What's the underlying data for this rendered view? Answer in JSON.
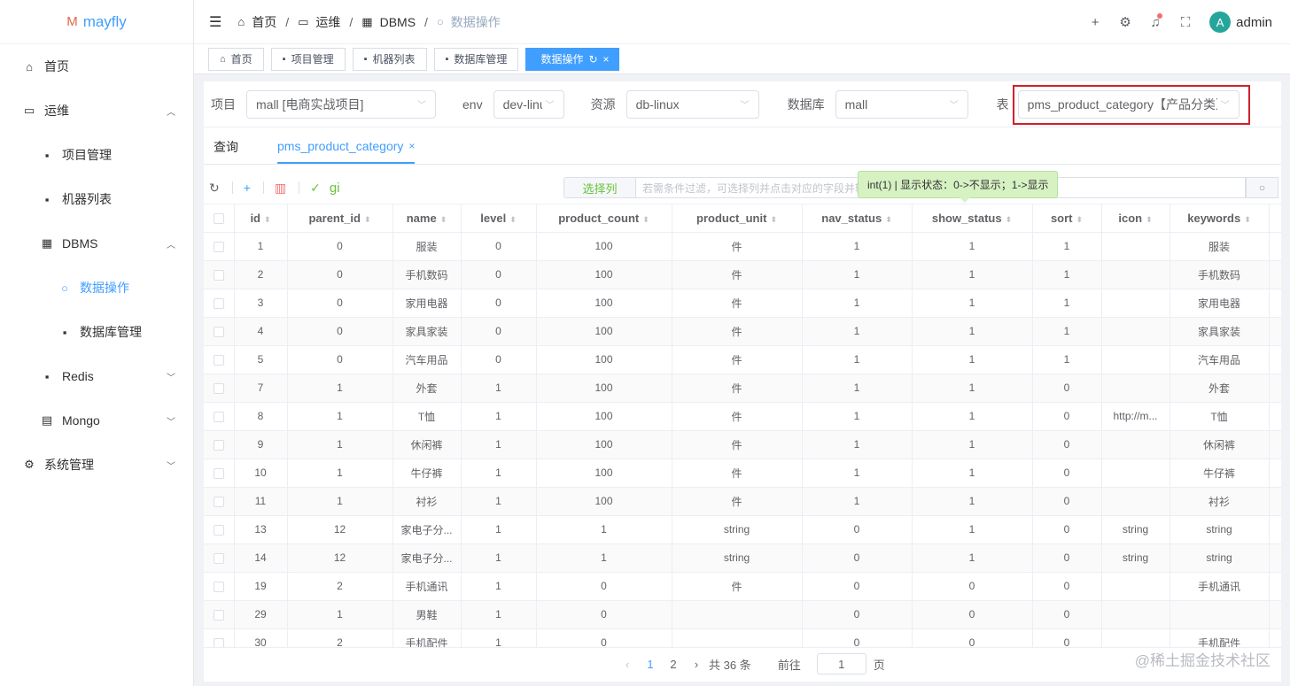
{
  "app": {
    "logo_mark": "M",
    "name": "mayfly"
  },
  "sidebar": {
    "items": [
      {
        "label": "首页",
        "icon": "home-icon"
      },
      {
        "label": "运维",
        "icon": "monitor-icon",
        "arrow": "︿"
      },
      {
        "label": "项目管理",
        "icon": "grid-icon"
      },
      {
        "label": "机器列表",
        "icon": "grid-icon"
      },
      {
        "label": "DBMS",
        "icon": "db-icon",
        "arrow": "︿"
      },
      {
        "label": "数据操作",
        "icon": "search-icon"
      },
      {
        "label": "数据库管理",
        "icon": "grid-icon"
      },
      {
        "label": "Redis",
        "icon": "grid-icon",
        "arrow": "﹀"
      },
      {
        "label": "Mongo",
        "icon": "doc-icon",
        "arrow": "﹀"
      },
      {
        "label": "系统管理",
        "icon": "gear-icon",
        "arrow": "﹀"
      }
    ]
  },
  "breadcrumb": {
    "home": "首页",
    "ops": "运维",
    "dbms": "DBMS",
    "current": "数据操作",
    "sep": "/"
  },
  "header": {
    "user": "admin",
    "avatar_letter": "A"
  },
  "tags": [
    {
      "label": "首页"
    },
    {
      "label": "项目管理"
    },
    {
      "label": "机器列表"
    },
    {
      "label": "数据库管理"
    },
    {
      "label": "数据操作"
    }
  ],
  "filters": {
    "project_label": "项目",
    "project_value": "mall [电商实战项目]",
    "env_label": "env",
    "env_value": "dev-linux",
    "resource_label": "资源",
    "resource_value": "db-linux",
    "db_label": "数据库",
    "db_value": "mall",
    "table_label": "表",
    "table_value": "pms_product_category【产品分类】"
  },
  "query_tabs": {
    "query": "查询",
    "table": "pms_product_category"
  },
  "toolbar": {
    "gi": "gi",
    "select_columns": "选择列",
    "filter_placeholder": "若需条件过滤，可选择列并点击对应的字段并输入需要过滤的内容"
  },
  "tooltip": "int(1) | 显示状态：0->不显示；1->显示",
  "table": {
    "columns": [
      "id",
      "parent_id",
      "name",
      "level",
      "product_count",
      "product_unit",
      "nav_status",
      "show_status",
      "sort",
      "icon",
      "keywords"
    ],
    "rows": [
      [
        "1",
        "0",
        "服装",
        "0",
        "100",
        "件",
        "1",
        "1",
        "1",
        "",
        "服装"
      ],
      [
        "2",
        "0",
        "手机数码",
        "0",
        "100",
        "件",
        "1",
        "1",
        "1",
        "",
        "手机数码"
      ],
      [
        "3",
        "0",
        "家用电器",
        "0",
        "100",
        "件",
        "1",
        "1",
        "1",
        "",
        "家用电器"
      ],
      [
        "4",
        "0",
        "家具家装",
        "0",
        "100",
        "件",
        "1",
        "1",
        "1",
        "",
        "家具家装"
      ],
      [
        "5",
        "0",
        "汽车用品",
        "0",
        "100",
        "件",
        "1",
        "1",
        "1",
        "",
        "汽车用品"
      ],
      [
        "7",
        "1",
        "外套",
        "1",
        "100",
        "件",
        "1",
        "1",
        "0",
        "",
        "外套"
      ],
      [
        "8",
        "1",
        "T恤",
        "1",
        "100",
        "件",
        "1",
        "1",
        "0",
        "http://m...",
        "T恤"
      ],
      [
        "9",
        "1",
        "休闲裤",
        "1",
        "100",
        "件",
        "1",
        "1",
        "0",
        "",
        "休闲裤"
      ],
      [
        "10",
        "1",
        "牛仔裤",
        "1",
        "100",
        "件",
        "1",
        "1",
        "0",
        "",
        "牛仔裤"
      ],
      [
        "11",
        "1",
        "衬衫",
        "1",
        "100",
        "件",
        "1",
        "1",
        "0",
        "",
        "衬衫"
      ],
      [
        "13",
        "12",
        "家电子分...",
        "1",
        "1",
        "string",
        "0",
        "1",
        "0",
        "string",
        "string"
      ],
      [
        "14",
        "12",
        "家电子分...",
        "1",
        "1",
        "string",
        "0",
        "1",
        "0",
        "string",
        "string"
      ],
      [
        "19",
        "2",
        "手机通讯",
        "1",
        "0",
        "件",
        "0",
        "0",
        "0",
        "",
        "手机通讯"
      ],
      [
        "29",
        "1",
        "男鞋",
        "1",
        "0",
        "",
        "0",
        "0",
        "0",
        "",
        ""
      ],
      [
        "30",
        "2",
        "手机配件",
        "1",
        "0",
        "",
        "0",
        "0",
        "0",
        "",
        "手机配件"
      ]
    ]
  },
  "pagination": {
    "page1": "1",
    "page2": "2",
    "total": "共 36 条",
    "goto": "前往",
    "goto_value": "1",
    "page_unit": "页"
  },
  "watermark": "@稀土掘金技术社区"
}
